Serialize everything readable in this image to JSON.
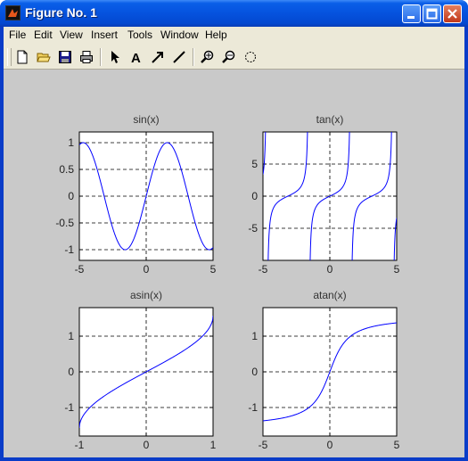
{
  "window": {
    "title": "Figure No. 1"
  },
  "menu": [
    "File",
    "Edit",
    "View",
    "Insert",
    "Tools",
    "Window",
    "Help"
  ],
  "toolbar": {
    "icons": [
      "new-file-icon",
      "open-folder-icon",
      "save-icon",
      "print-icon",
      "arrow-select-icon",
      "text-icon",
      "arrow-icon",
      "line-icon",
      "zoom-in-icon",
      "zoom-out-icon",
      "rotate-icon"
    ]
  },
  "colors": {
    "curve": "#0000ff",
    "titlebar": "#0552de",
    "figure_bg": "#c9c9c9"
  },
  "chart_data": [
    {
      "type": "line",
      "title": "sin(x)",
      "function": "sin",
      "xlim": [
        -5,
        5
      ],
      "ylim": [
        -1.2,
        1.2
      ],
      "xticks": [
        -5,
        0,
        5
      ],
      "yticks": [
        -1,
        -0.5,
        0,
        0.5,
        1
      ],
      "xtick_labels": [
        "-5",
        "0",
        "5"
      ],
      "ytick_labels": [
        "-1",
        "-0.5",
        "0",
        "0.5",
        "1"
      ],
      "grid": true
    },
    {
      "type": "line",
      "title": "tan(x)",
      "function": "tan",
      "xlim": [
        -5,
        5
      ],
      "ylim": [
        -10,
        10
      ],
      "xticks": [
        -5,
        0,
        5
      ],
      "yticks": [
        -5,
        0,
        5
      ],
      "xtick_labels": [
        "-5",
        "0",
        "5"
      ],
      "ytick_labels": [
        "-5",
        "0",
        "5"
      ],
      "grid": true
    },
    {
      "type": "line",
      "title": "asin(x)",
      "function": "asin",
      "xlim": [
        -1,
        1
      ],
      "ylim": [
        -1.8,
        1.8
      ],
      "xticks": [
        -1,
        0,
        1
      ],
      "yticks": [
        -1,
        0,
        1
      ],
      "xtick_labels": [
        "-1",
        "0",
        "1"
      ],
      "ytick_labels": [
        "-1",
        "0",
        "1"
      ],
      "grid": true
    },
    {
      "type": "line",
      "title": "atan(x)",
      "function": "atan",
      "xlim": [
        -5,
        5
      ],
      "ylim": [
        -1.8,
        1.8
      ],
      "xticks": [
        -5,
        0,
        5
      ],
      "yticks": [
        -1,
        0,
        1
      ],
      "xtick_labels": [
        "-5",
        "0",
        "5"
      ],
      "ytick_labels": [
        "-1",
        "0",
        "1"
      ],
      "grid": true
    }
  ]
}
